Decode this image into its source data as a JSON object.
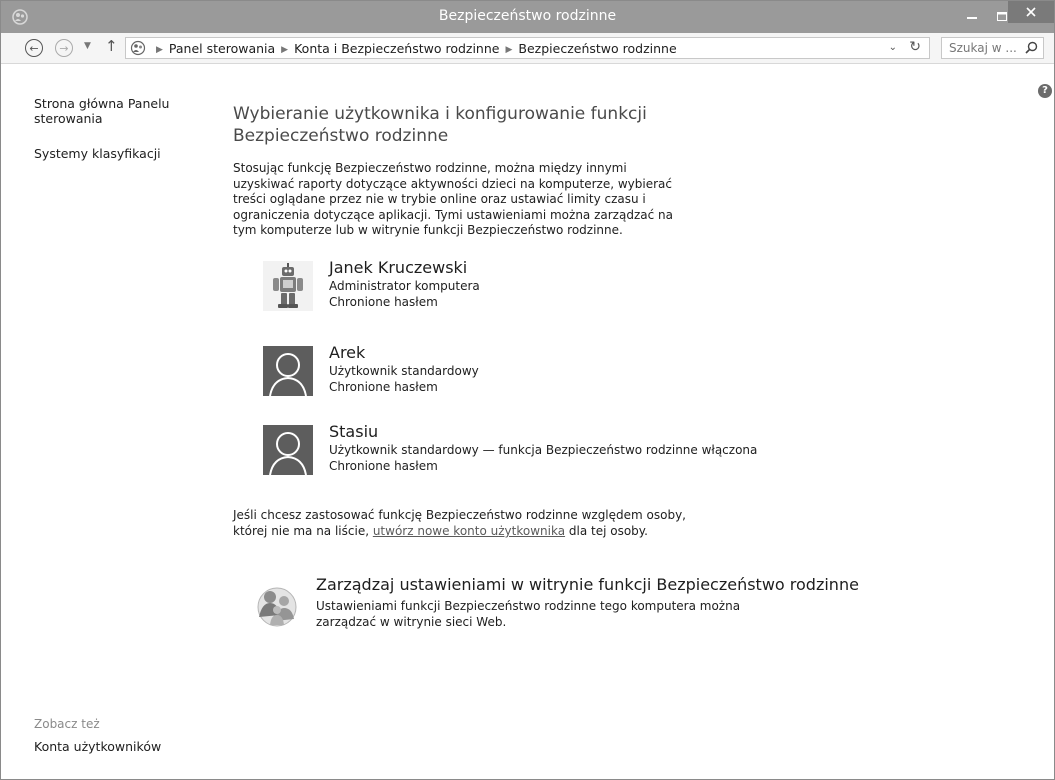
{
  "window": {
    "title": "Bezpieczeństwo rodzinne"
  },
  "address_bar": {
    "breadcrumbs": [
      "Panel sterowania",
      "Konta i Bezpieczeństwo rodzinne",
      "Bezpieczeństwo rodzinne"
    ]
  },
  "search": {
    "placeholder": "Szukaj w ..."
  },
  "sidebar": {
    "home_link": "Strona główna Panelu sterowania",
    "ratings_link": "Systemy klasyfikacji",
    "see_also_label": "Zobacz też",
    "user_accounts_link": "Konta użytkowników"
  },
  "main": {
    "heading": "Wybieranie użytkownika i konfigurowanie funkcji Bezpieczeństwo rodzinne",
    "intro": "Stosując funkcję Bezpieczeństwo rodzinne, można między innymi uzyskiwać raporty dotyczące aktywności dzieci na komputerze, wybierać treści oglądane przez nie w trybie online oraz ustawiać limity czasu i ograniczenia dotyczące aplikacji. Tymi ustawieniami można zarządzać na tym komputerze lub w witrynie funkcji Bezpieczeństwo rodzinne.",
    "users": [
      {
        "name": "Janek Kruczewski",
        "type": "Administrator komputera",
        "protection": "Chronione hasłem",
        "avatar": "robot-icon"
      },
      {
        "name": "Arek",
        "type": "Użytkownik standardowy",
        "protection": "Chronione hasłem",
        "avatar": "default-user-icon"
      },
      {
        "name": "Stasiu",
        "type": "Użytkownik standardowy — funkcja Bezpieczeństwo rodzinne włączona",
        "protection": "Chronione hasłem",
        "avatar": "default-user-icon"
      }
    ],
    "note_prefix": "Jeśli chcesz zastosować funkcję Bezpieczeństwo rodzinne względem osoby, której nie ma na liście, ",
    "note_link": "utwórz nowe konto użytkownika",
    "note_suffix": " dla tej osoby.",
    "manage": {
      "title": "Zarządzaj ustawieniami w witrynie funkcji Bezpieczeństwo rodzinne",
      "description": "Ustawieniami funkcji Bezpieczeństwo rodzinne tego komputera można zarządzać w witrynie sieci Web."
    }
  },
  "colors": {
    "titlebar": "#9a9a9a",
    "close_button": "#7a7a7a",
    "avatar_bg": "#5d5d5d"
  }
}
